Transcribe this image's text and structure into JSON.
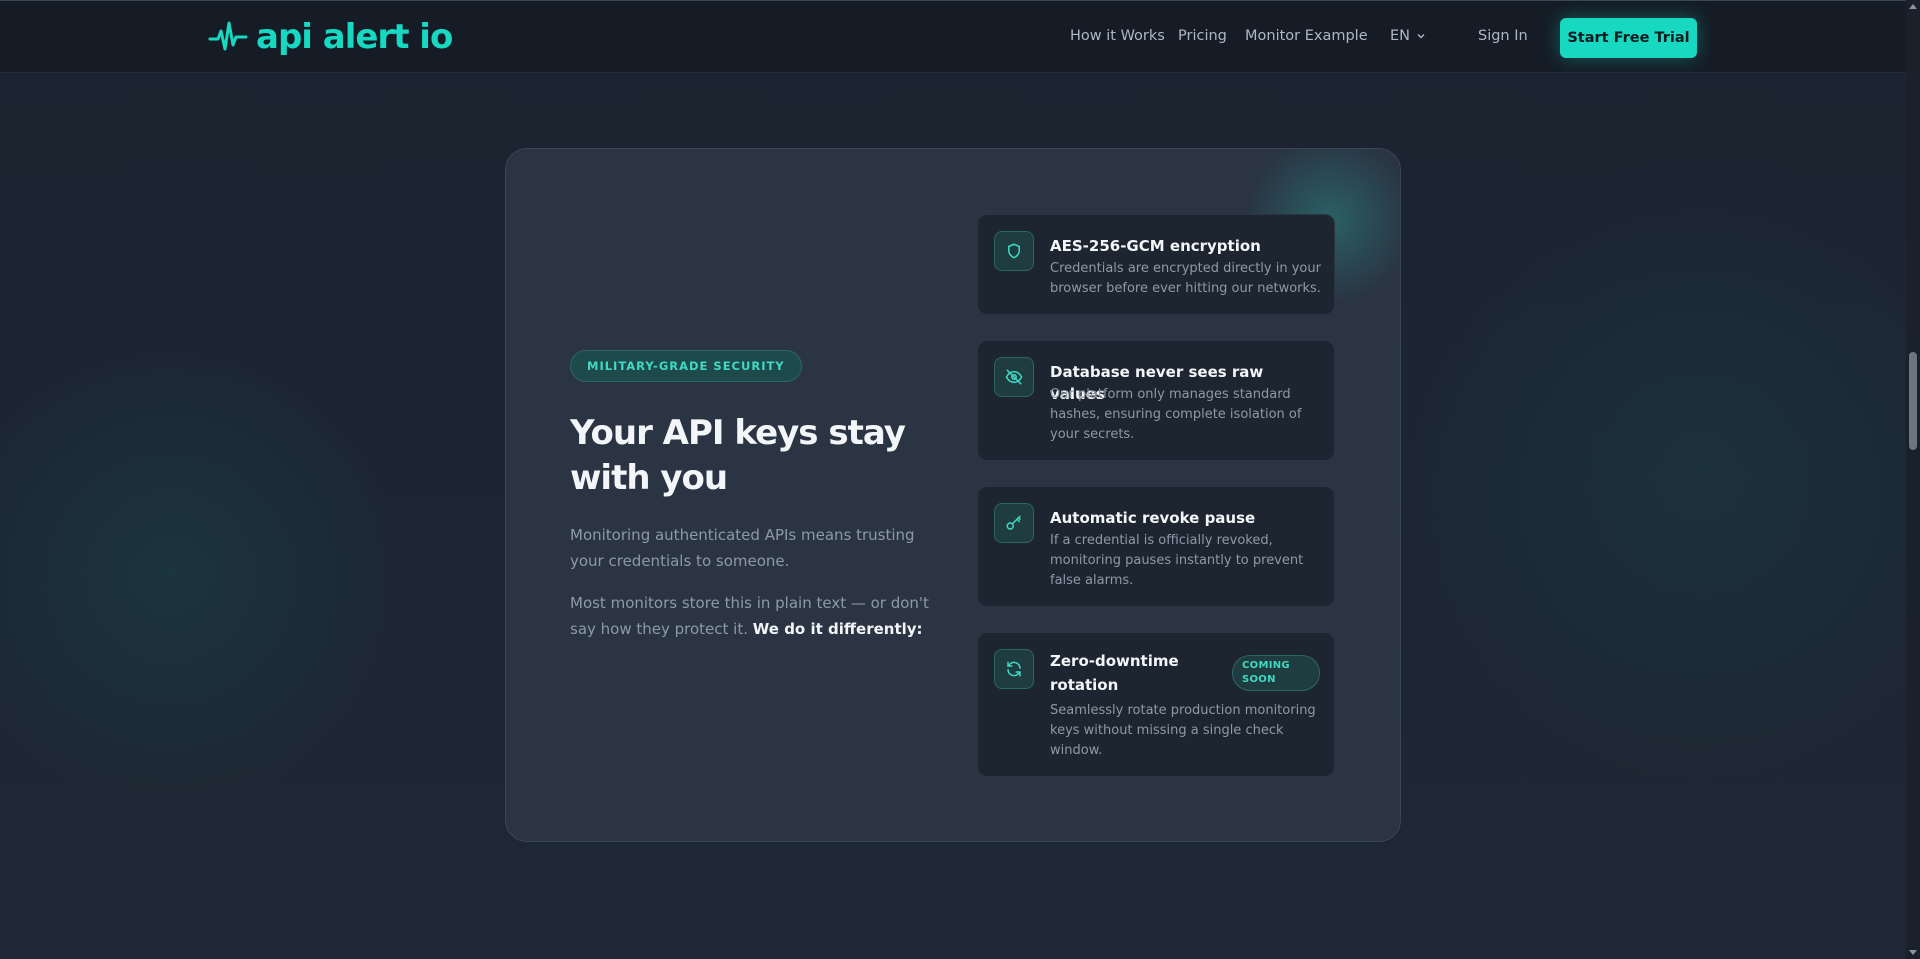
{
  "brand": {
    "name": "api alert io",
    "accent": "#17d8c0"
  },
  "nav": {
    "links": [
      "How it Works",
      "Pricing",
      "Monitor Example"
    ],
    "language": "EN",
    "sign_in": "Sign In",
    "cta": "Start Free Trial"
  },
  "security": {
    "badge": "MILITARY-GRADE SECURITY",
    "headline": "Your API keys stay with you",
    "para1": "Monitoring authenticated APIs means trusting your credentials to someone.",
    "para2_prefix": "Most monitors store this in plain text — or don't say how they protect it.",
    "para2_strong": "We do it differently:",
    "features": [
      {
        "icon": "shield-icon",
        "title": "AES-256-GCM encryption",
        "description": "Credentials are encrypted directly in your browser before ever hitting our networks."
      },
      {
        "icon": "eye-off-icon",
        "title": "Database never sees raw values",
        "description": "Our platform only manages standard hashes, ensuring complete isolation of your secrets."
      },
      {
        "icon": "key-icon",
        "title": "Automatic revoke pause",
        "description": "If a credential is officially revoked, monitoring pauses instantly to prevent false alarms."
      },
      {
        "icon": "refresh-icon",
        "title": "Zero-downtime rotation",
        "badge": "COMING SOON",
        "description": "Seamlessly rotate production monitoring keys without missing a single check window."
      }
    ]
  }
}
